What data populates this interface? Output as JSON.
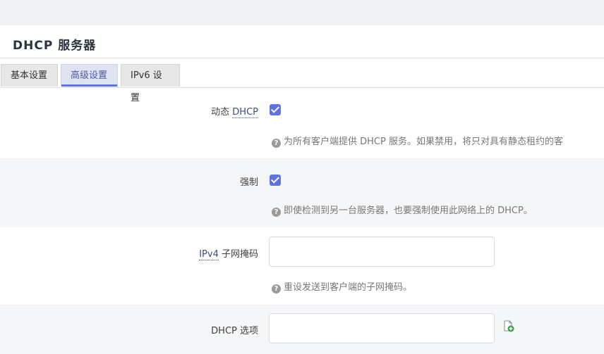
{
  "section": {
    "title": "DHCP 服务器"
  },
  "tabs": [
    {
      "label": "基本设置",
      "active": false
    },
    {
      "label": "高级设置",
      "active": true
    },
    {
      "label": "IPv6 设置",
      "active": false
    }
  ],
  "colors": {
    "accent": "#5e72e4",
    "row_alt": "#f5f6f7"
  },
  "rows": {
    "dynamic_dhcp": {
      "label_prefix": "动态 ",
      "label_abbr": "DHCP",
      "checked": true,
      "help": "为所有客户端提供 DHCP 服务。如果禁用，将只对具有静态租约的客"
    },
    "force": {
      "label": "强制",
      "checked": true,
      "help": "即使检测到另一台服务器，也要强制使用此网络上的 DHCP。"
    },
    "netmask": {
      "label_abbr": "IPv4",
      "label_suffix": " 子网掩码",
      "value": "",
      "help": "重设发送到客户端的子网掩码。"
    },
    "dhcp_options": {
      "label": "DHCP 选项",
      "value": "",
      "add_icon": "add-entry-icon"
    }
  },
  "help_icon": "?"
}
